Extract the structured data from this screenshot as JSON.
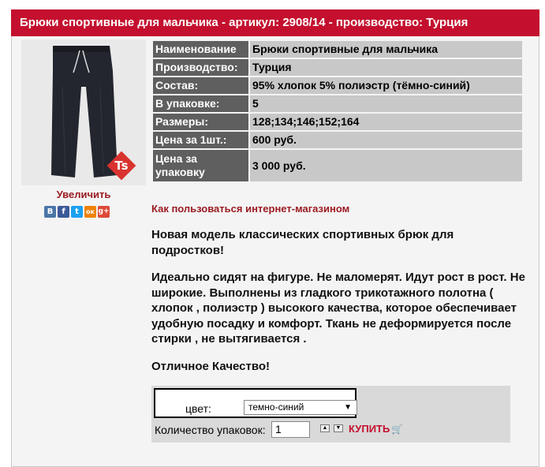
{
  "header": {
    "title": "Брюки спортивные для мальчика - артикул: 2908/14 - производство: Турция"
  },
  "product_image": {
    "enlarge_label": "Увеличить",
    "brand_mark": "Ts"
  },
  "social": [
    {
      "name": "vk",
      "glyph": "В",
      "color": "#4a76a8"
    },
    {
      "name": "facebook",
      "glyph": "f",
      "color": "#3b5998"
    },
    {
      "name": "twitter",
      "glyph": "t",
      "color": "#1da1f2"
    },
    {
      "name": "odnoklassniki",
      "glyph": "ок",
      "color": "#ee8208"
    },
    {
      "name": "google-plus",
      "glyph": "g+",
      "color": "#dc4a38"
    }
  ],
  "specs": [
    {
      "key": "Наименование",
      "value": "Брюки спортивные для мальчика"
    },
    {
      "key": "Производство:",
      "value": "Турция"
    },
    {
      "key": "Состав:",
      "value": "95% хлопок 5% полиэстр (тёмно-синий)"
    },
    {
      "key": "В упаковке:",
      "value": "5"
    },
    {
      "key": "Размеры:",
      "value": "128;134;146;152;164"
    },
    {
      "key": "Цена за 1шт.:",
      "value": "600 руб."
    },
    {
      "key": "Цена за упаковку",
      "value": "3 000 руб."
    }
  ],
  "howto_link": "Как пользоваться интернет-магазином",
  "description": [
    "Новая модель классических спортивных брюк для подростков!",
    "Идеально сидят на фигуре. Не маломерят. Идут рост в рост. Не широкие.  Выполнены из гладкого трикотажного полотна ( хлопок ,  полиэстр ) высокого качества, которое обеспечивает удобную посадку и комфорт. Ткань не деформируется после стирки , не вытягивается .",
    "Отличное Качество!"
  ],
  "order": {
    "color_label": "цвет:",
    "color_selected": "темно-синий",
    "quantity_label": "Количество упаковок:",
    "quantity_value": "1",
    "buy_label": "КУПИТЬ"
  }
}
